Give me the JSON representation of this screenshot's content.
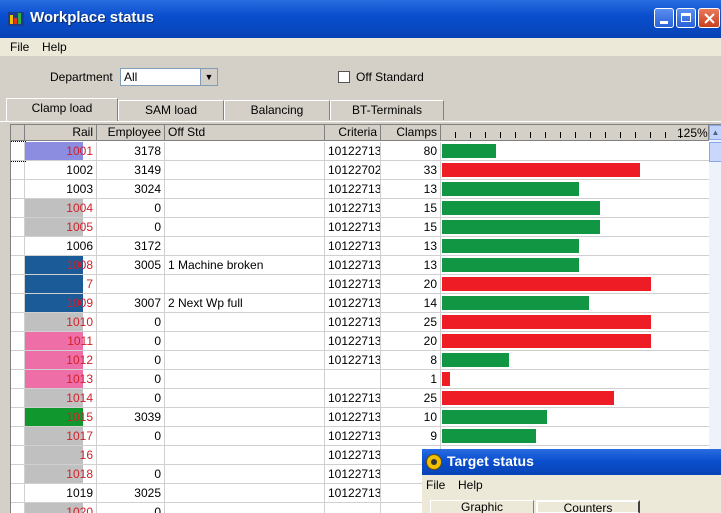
{
  "window": {
    "title": "Workplace status"
  },
  "menu": {
    "file": "File",
    "help": "Help"
  },
  "filters": {
    "department_label": "Department",
    "department_value": "All",
    "off_standard_label": "Off Standard",
    "off_standard_checked": false
  },
  "tabs": [
    {
      "label": "Clamp load",
      "active": true
    },
    {
      "label": "SAM load",
      "active": false
    },
    {
      "label": "Balancing",
      "active": false
    },
    {
      "label": "BT-Terminals",
      "active": false
    }
  ],
  "columns": {
    "rail": "Rail",
    "employee": "Employee",
    "off_std": "Off Std",
    "criteria": "Criteria",
    "clamps": "Clamps",
    "scale_max": "125%"
  },
  "colors": {
    "green": "#119644",
    "red": "#ee1c25",
    "violet": "#8c8ce0",
    "blue": "#1b5b97",
    "pink": "#ee6fa8",
    "grey": "#c0c0c0",
    "dkgreen": "#10982e"
  },
  "rows": [
    {
      "rail": "1001",
      "rail_color": "violet",
      "employee": "3178",
      "off_std": "",
      "criteria": "10122713",
      "clamps": "80",
      "load": 0.2,
      "bar_color": "green"
    },
    {
      "rail": "1002",
      "rail_color": "",
      "employee": "3149",
      "off_std": "",
      "criteria": "10122702",
      "clamps": "33",
      "load": 0.74,
      "bar_color": "red"
    },
    {
      "rail": "1003",
      "rail_color": "",
      "employee": "3024",
      "off_std": "",
      "criteria": "10122713",
      "clamps": "13",
      "load": 0.51,
      "bar_color": "green"
    },
    {
      "rail": "1004",
      "rail_color": "grey",
      "employee": "0",
      "off_std": "",
      "criteria": "10122713",
      "clamps": "15",
      "load": 0.59,
      "bar_color": "green"
    },
    {
      "rail": "1005",
      "rail_color": "grey",
      "employee": "0",
      "off_std": "",
      "criteria": "10122713",
      "clamps": "15",
      "load": 0.59,
      "bar_color": "green"
    },
    {
      "rail": "1006",
      "rail_color": "",
      "employee": "3172",
      "off_std": "",
      "criteria": "10122713",
      "clamps": "13",
      "load": 0.51,
      "bar_color": "green"
    },
    {
      "rail": "1008",
      "rail_color": "blue",
      "employee": "3005",
      "off_std": "1  Machine broken",
      "criteria": "10122713",
      "clamps": "13",
      "load": 0.51,
      "bar_color": "green"
    },
    {
      "rail": "7",
      "rail_color": "blue",
      "employee": "",
      "off_std": "",
      "criteria": "10122713",
      "clamps": "20",
      "load": 0.78,
      "bar_color": "red"
    },
    {
      "rail": "1009",
      "rail_color": "blue",
      "employee": "3007",
      "off_std": "2  Next Wp full",
      "criteria": "10122713",
      "clamps": "14",
      "load": 0.55,
      "bar_color": "green"
    },
    {
      "rail": "1010",
      "rail_color": "grey",
      "employee": "0",
      "off_std": "",
      "criteria": "10122713",
      "clamps": "25",
      "load": 0.78,
      "bar_color": "red"
    },
    {
      "rail": "1011",
      "rail_color": "pink",
      "employee": "0",
      "off_std": "",
      "criteria": "10122713",
      "clamps": "20",
      "load": 0.78,
      "bar_color": "red"
    },
    {
      "rail": "1012",
      "rail_color": "pink",
      "employee": "0",
      "off_std": "",
      "criteria": "10122713",
      "clamps": "8",
      "load": 0.25,
      "bar_color": "green"
    },
    {
      "rail": "1013",
      "rail_color": "pink",
      "employee": "0",
      "off_std": "",
      "criteria": "",
      "clamps": "1",
      "load": 0.03,
      "bar_color": "red"
    },
    {
      "rail": "1014",
      "rail_color": "grey",
      "employee": "0",
      "off_std": "",
      "criteria": "10122713",
      "clamps": "25",
      "load": 0.64,
      "bar_color": "red"
    },
    {
      "rail": "1015",
      "rail_color": "dkgreen",
      "employee": "3039",
      "off_std": "",
      "criteria": "10122713",
      "clamps": "10",
      "load": 0.39,
      "bar_color": "green"
    },
    {
      "rail": "1017",
      "rail_color": "grey",
      "employee": "0",
      "off_std": "",
      "criteria": "10122713",
      "clamps": "9",
      "load": 0.35,
      "bar_color": "green"
    },
    {
      "rail": "16",
      "rail_color": "grey",
      "employee": "",
      "off_std": "",
      "criteria": "10122713",
      "clamps": "",
      "load": 0,
      "bar_color": "green"
    },
    {
      "rail": "1018",
      "rail_color": "grey",
      "employee": "0",
      "off_std": "",
      "criteria": "10122713",
      "clamps": "",
      "load": 0,
      "bar_color": "green"
    },
    {
      "rail": "1019",
      "rail_color": "",
      "employee": "3025",
      "off_std": "",
      "criteria": "10122713",
      "clamps": "",
      "load": 0,
      "bar_color": "green"
    },
    {
      "rail": "1020",
      "rail_color": "grey",
      "employee": "0",
      "off_std": "",
      "criteria": "",
      "clamps": "",
      "load": 0,
      "bar_color": "green"
    }
  ],
  "target_window": {
    "title": "Target status",
    "menu_file": "File",
    "menu_help": "Help",
    "tab_graphic": "Graphic",
    "tab_counters": "Counters"
  }
}
